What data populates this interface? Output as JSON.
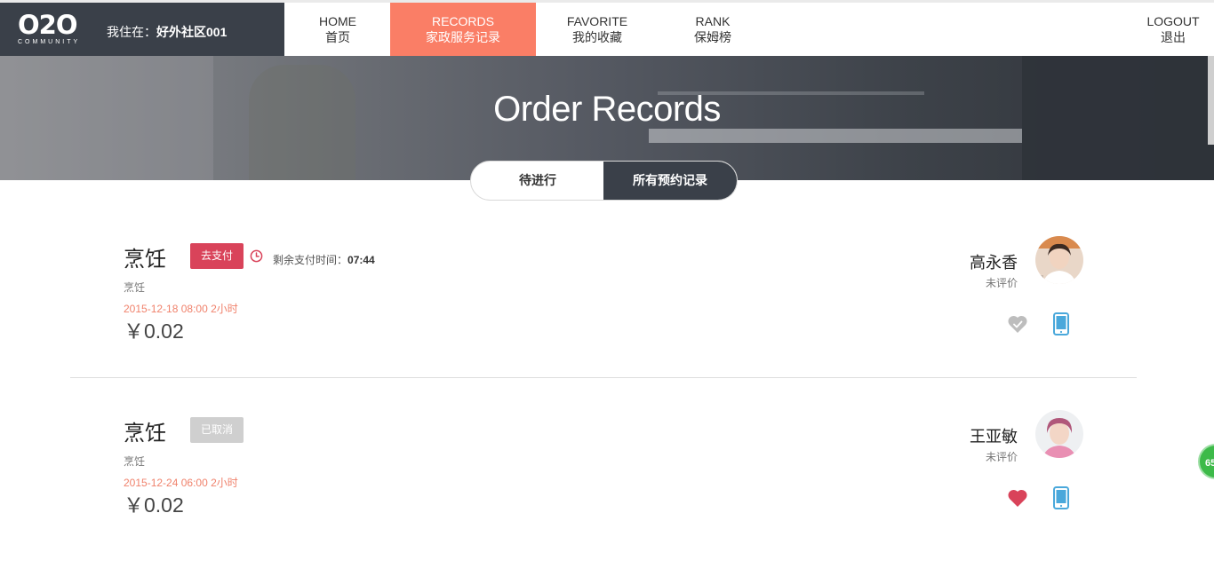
{
  "header": {
    "logo_main": "O2O",
    "logo_sub": "COMMUNITY",
    "location_label": "我住在：",
    "location_value": "好外社区001",
    "nav": [
      {
        "en": "HOME",
        "zh": "首页"
      },
      {
        "en": "RECORDS",
        "zh": "家政服务记录",
        "active": true
      },
      {
        "en": "FAVORITE",
        "zh": "我的收藏"
      },
      {
        "en": "RANK",
        "zh": "保姆榜"
      }
    ],
    "logout": {
      "en": "LOGOUT",
      "zh": "退出"
    }
  },
  "banner": {
    "title": "Order Records"
  },
  "tabs": {
    "pending": "待进行",
    "all": "所有预约记录"
  },
  "orders": [
    {
      "service": "烹饪",
      "status": "去支付",
      "countdown_label": "剩余支付时间：",
      "countdown_value": "07:44",
      "subtitle": "烹饪",
      "datetime": "2015-12-18 08:00 2小时",
      "price": "￥0.02",
      "staff_name": "高永香",
      "staff_state": "未评价",
      "favorited": false
    },
    {
      "service": "烹饪",
      "status": "已取消",
      "subtitle": "烹饪",
      "datetime": "2015-12-24 06:00 2小时",
      "price": "￥0.02",
      "staff_name": "王亚敏",
      "staff_state": "未评价",
      "favorited": true
    }
  ],
  "floating_badge": "65",
  "colors": {
    "brand_dark": "#3a4049",
    "accent_coral": "#fa7e66",
    "pay_red": "#d9435a",
    "date_orange": "#f0826c",
    "phone_blue": "#4aa8db",
    "heart_grey": "#bdbdbd",
    "heart_red": "#d9435a"
  },
  "icons": [
    "clock-icon",
    "heart-icon",
    "phone-icon"
  ]
}
